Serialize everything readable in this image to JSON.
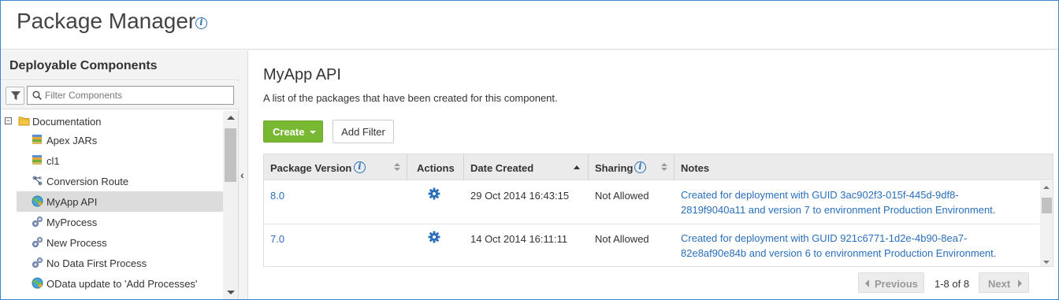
{
  "app": {
    "title": "Package Manager",
    "title_info_icon": "info-icon"
  },
  "sidebar": {
    "heading": "Deployable Components",
    "filter_placeholder": "Filter Components",
    "filter_icon": "funnel-icon",
    "search_icon": "search-icon",
    "root": {
      "label": "Documentation",
      "collapse_symbol": "−",
      "icon": "folder-icon"
    },
    "items": [
      {
        "label": "Apex JARs",
        "icon": "jar-stack-icon"
      },
      {
        "label": "cl1",
        "icon": "jar-stack-icon"
      },
      {
        "label": "Conversion Route",
        "icon": "route-icon"
      },
      {
        "label": "MyApp API",
        "icon": "globe-api-icon",
        "selected": true
      },
      {
        "label": "MyProcess",
        "icon": "process-gears-icon"
      },
      {
        "label": "New Process",
        "icon": "process-gears-icon"
      },
      {
        "label": "No Data First Process",
        "icon": "process-gears-icon"
      },
      {
        "label": "OData update to 'Add Processes'",
        "icon": "globe-api-icon"
      }
    ]
  },
  "splitter": {
    "collapse_symbol": "‹"
  },
  "main": {
    "title": "MyApp API",
    "description": "A list of the packages that have been created for this component.",
    "create_label": "Create",
    "add_filter_label": "Add Filter"
  },
  "grid": {
    "columns": [
      "Package Version",
      "Actions",
      "Date Created",
      "Sharing",
      "Notes"
    ],
    "sorted_column": "Date Created",
    "rows": [
      {
        "version": "8.0",
        "action_icon": "gear-icon",
        "date": "29 Oct 2014 16:43:15",
        "sharing": "Not Allowed",
        "notes_line1": "Created for deployment with GUID 3ac902f3-015f-445d-9df8-",
        "notes_line2": "2819f9040a11 and version 7 to environment Production Environment."
      },
      {
        "version": "7.0",
        "action_icon": "gear-icon",
        "date": "14 Oct 2014 16:11:11",
        "sharing": "Not Allowed",
        "notes_line1": "Created for deployment with GUID 921c6771-1d2e-4b90-8ea7-",
        "notes_line2": "82e8af90e84b and version 6 to environment Production Environment."
      }
    ]
  },
  "pager": {
    "previous_label": "Previous",
    "count": "1-8 of 8",
    "next_label": "Next"
  },
  "colors": {
    "accent": "#2a6fbb",
    "create_button": "#79b833",
    "frame_border": "#3b87c9",
    "selected_row": "#dcdcdc"
  }
}
